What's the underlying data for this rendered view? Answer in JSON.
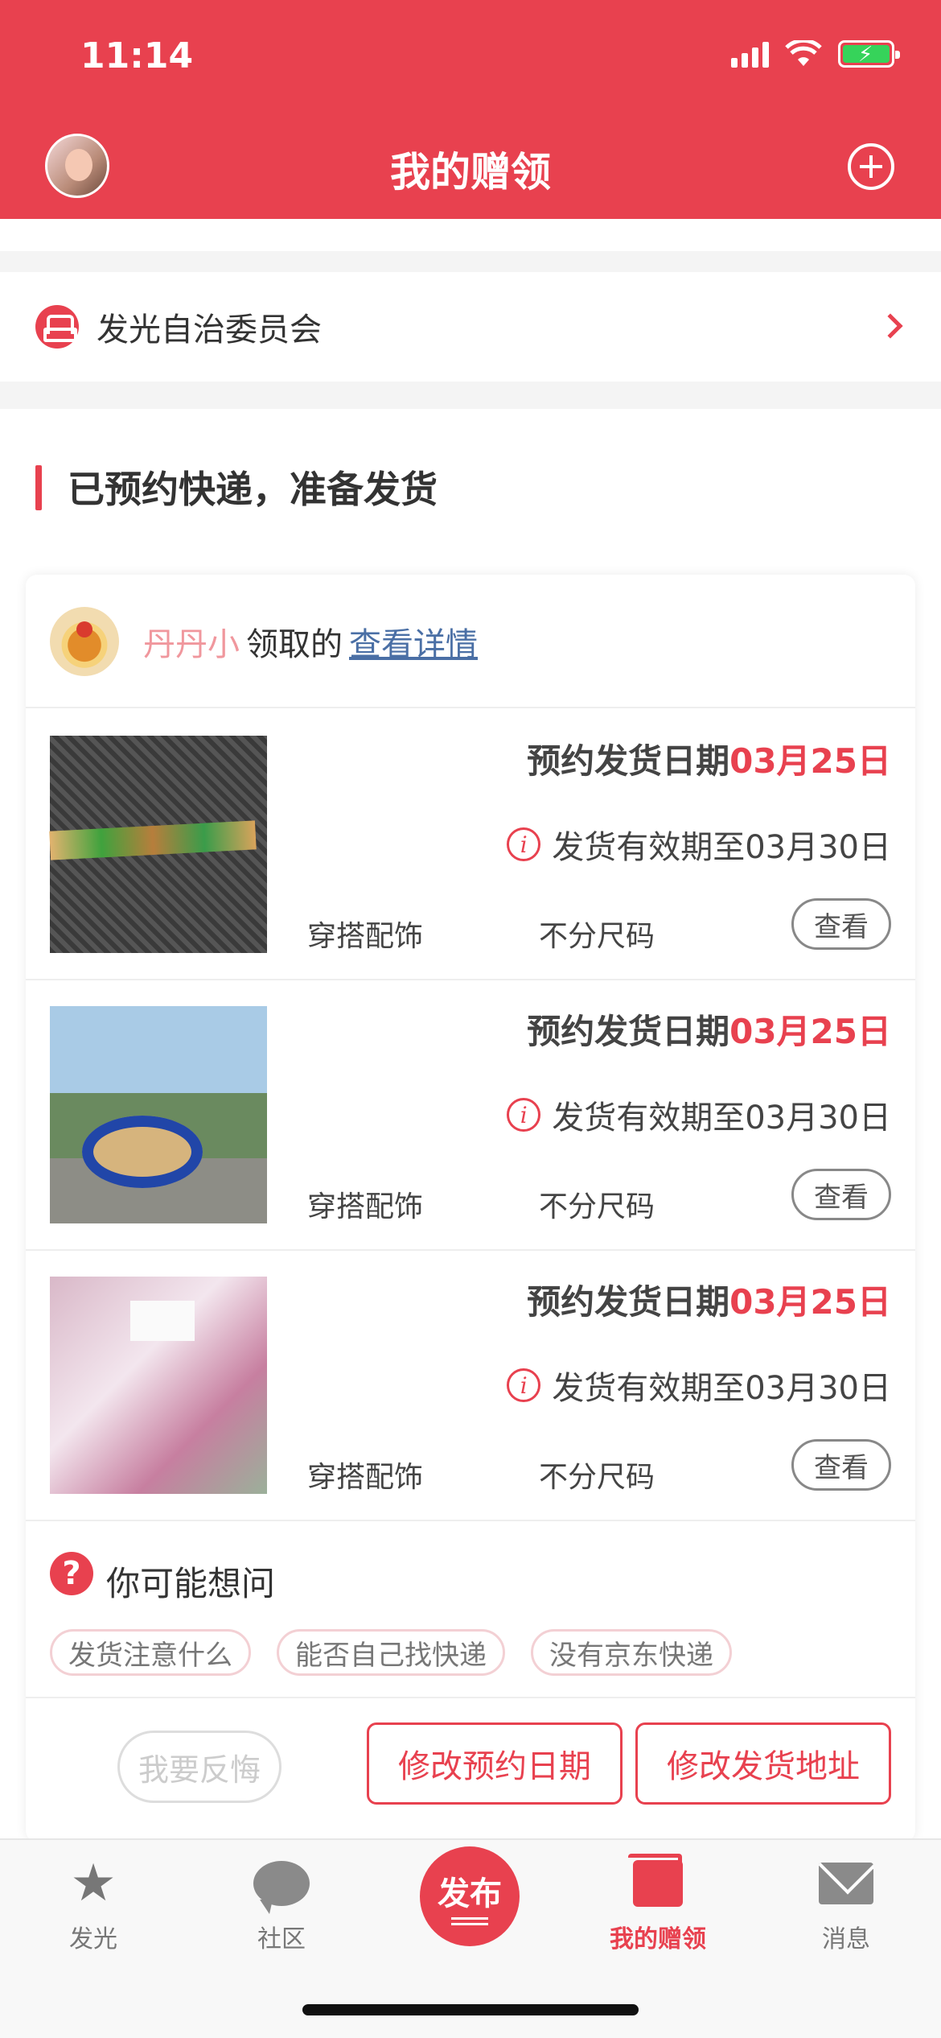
{
  "status_bar": {
    "time": "11:14"
  },
  "header": {
    "title": "我的赠领"
  },
  "committee": {
    "label": "发光自治委员会"
  },
  "section": {
    "title": "已预约快递，准备发货"
  },
  "card": {
    "giver_name": "丹丹小",
    "taken_text": "领取的",
    "detail_link": "查看详情",
    "items": [
      {
        "date_label": "预约发货日期",
        "date_value": "03月25日",
        "expiry": "发货有效期至03月30日",
        "category": "穿搭配饰",
        "size": "不分尺码",
        "view_label": "查看"
      },
      {
        "date_label": "预约发货日期",
        "date_value": "03月25日",
        "expiry": "发货有效期至03月30日",
        "category": "穿搭配饰",
        "size": "不分尺码",
        "view_label": "查看"
      },
      {
        "date_label": "预约发货日期",
        "date_value": "03月25日",
        "expiry": "发货有效期至03月30日",
        "category": "穿搭配饰",
        "size": "不分尺码",
        "view_label": "查看"
      }
    ],
    "faq": {
      "title": "你可能想问",
      "chips": [
        "发货注意什么",
        "能否自己找快递",
        "没有京东快递"
      ]
    },
    "actions": {
      "regret": "我要反悔",
      "change_date": "修改预约日期",
      "change_address": "修改发货地址"
    }
  },
  "tabbar": {
    "tabs": [
      {
        "label": "发光",
        "icon": "star-icon"
      },
      {
        "label": "社区",
        "icon": "chat-bubble-icon"
      },
      {
        "label": "发布",
        "icon": "publish-icon"
      },
      {
        "label": "我的赠领",
        "icon": "gift-box-icon",
        "active": true
      },
      {
        "label": "消息",
        "icon": "mail-icon"
      }
    ]
  },
  "colors": {
    "accent": "#e8414f",
    "chip_border": "#f3d0d4",
    "link": "#4a6fa5"
  }
}
